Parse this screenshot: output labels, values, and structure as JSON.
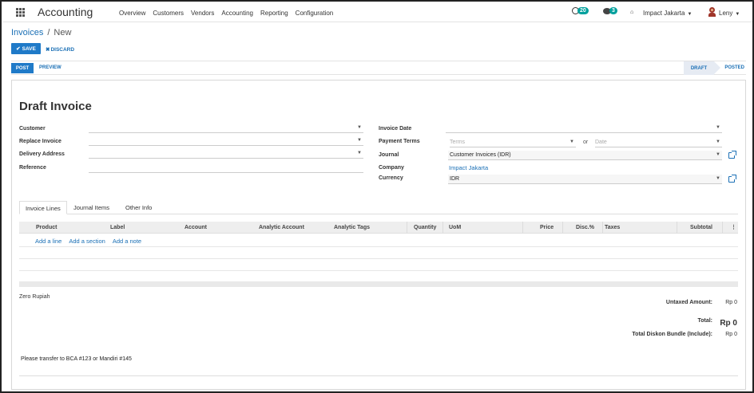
{
  "navbar": {
    "app_name": "Accounting",
    "menu": [
      "Overview",
      "Customers",
      "Vendors",
      "Accounting",
      "Reporting",
      "Configuration"
    ],
    "activity_count": "20",
    "message_count": "3",
    "company": "Impact Jakarta",
    "user": "Leny"
  },
  "breadcrumb": {
    "parent": "Invoices",
    "separator": "/",
    "current": "New"
  },
  "buttons": {
    "save": "SAVE",
    "discard": "DISCARD",
    "post": "POST",
    "preview": "PREVIEW"
  },
  "status": {
    "draft": "DRAFT",
    "posted": "POSTED"
  },
  "form": {
    "title": "Draft Invoice",
    "left": {
      "customer_label": "Customer",
      "replace_label": "Replace Invoice",
      "delivery_label": "Delivery Address",
      "reference_label": "Reference"
    },
    "right": {
      "invoice_date_label": "Invoice Date",
      "payment_terms_label": "Payment Terms",
      "terms_placeholder": "Terms",
      "or_text": "or",
      "date_placeholder": "Date",
      "journal_label": "Journal",
      "journal_value": "Customer Invoices (IDR)",
      "company_label": "Company",
      "company_value": "Impact Jakarta",
      "currency_label": "Currency",
      "currency_value": "IDR"
    }
  },
  "tabs": [
    "Invoice Lines",
    "Journal Items",
    "Other Info"
  ],
  "table": {
    "columns": [
      "Product",
      "Label",
      "Account",
      "Analytic Account",
      "Analytic Tags",
      "Quantity",
      "UoM",
      "Price",
      "Disc.%",
      "Taxes",
      "Subtotal"
    ],
    "actions": [
      "Add a line",
      "Add a section",
      "Add a note"
    ]
  },
  "totals": {
    "amount_in_words": "Zero Rupiah",
    "untaxed_label": "Untaxed Amount:",
    "untaxed_value": "Rp 0",
    "total_label": "Total:",
    "total_value": "Rp 0",
    "bundle_label": "Total Diskon Bundle (Include):",
    "bundle_value": "Rp 0"
  },
  "narration": "Please transfer to BCA #123 or Mandiri #145"
}
